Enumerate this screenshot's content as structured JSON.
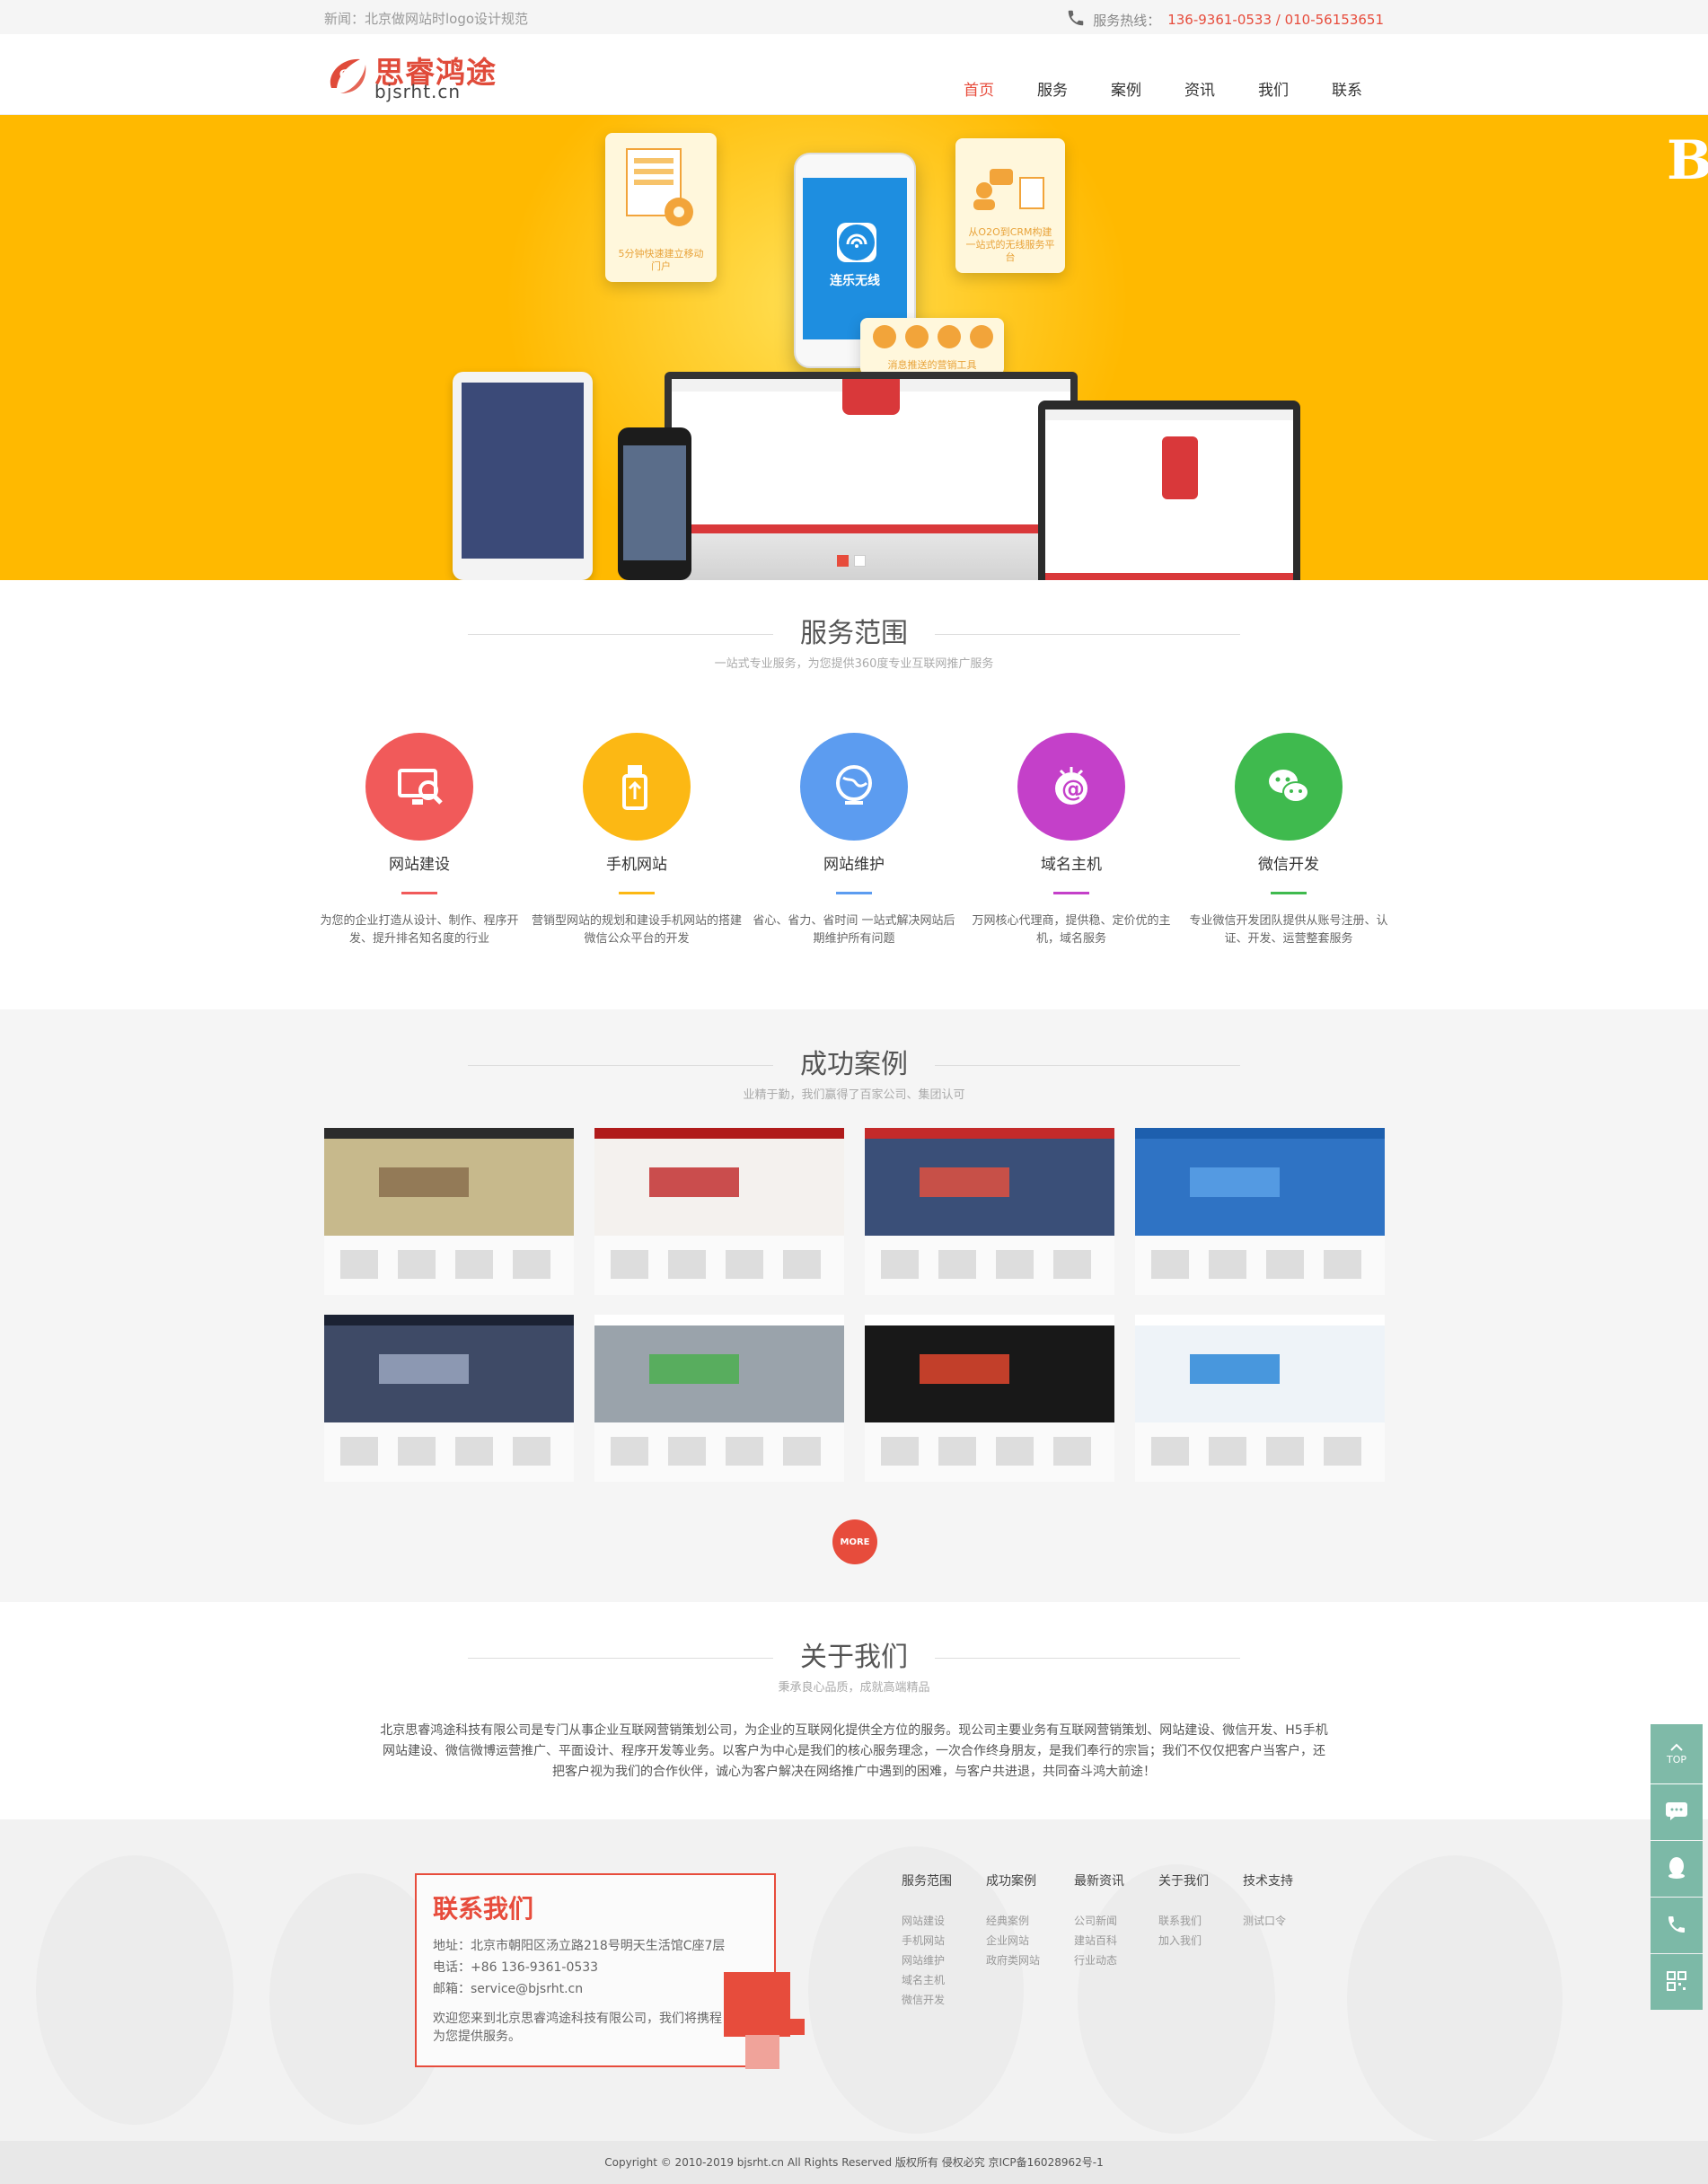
{
  "topbar": {
    "news": "新闻：北京做网站时logo设计规范",
    "hotline_label": "服务热线：",
    "hotline_numbers": "136-9361-0533 / 010-56153651"
  },
  "header": {
    "logo_cn": "思睿鸿途",
    "logo_en": "bjsrht.cn",
    "nav": [
      "首页",
      "服务",
      "案例",
      "资讯",
      "我们",
      "联系"
    ]
  },
  "banner": {
    "card_left": "5分钟快速建立移动门户",
    "card_right": "从O2O到CRM构建一站式的无线服务平台",
    "card_bottom": "消息推送的营销工具",
    "phone_app": "连乐无线",
    "big_letter": "B"
  },
  "services": {
    "title": "服务范围",
    "subtitle": "一站式专业服务，为您提供360度专业互联网推广服务",
    "items": [
      {
        "name": "网站建设",
        "desc": "为您的企业打造从设计、制作、程序开发、提升排名知名度的行业",
        "color": "#f15a5a",
        "icon": "monitor-search-icon"
      },
      {
        "name": "手机网站",
        "desc": "营销型网站的规划和建设手机网站的搭建微信公众平台的开发",
        "color": "#fcb814",
        "icon": "usb-drive-icon"
      },
      {
        "name": "网站维护",
        "desc": "省心、省力、省时间 一站式解决网站后期维护所有问题",
        "color": "#5c9cf0",
        "icon": "globe-icon"
      },
      {
        "name": "域名主机",
        "desc": "万网核心代理商，提供稳、定价优的主机，域名服务",
        "color": "#c440c9",
        "icon": "at-sign-icon"
      },
      {
        "name": "微信开发",
        "desc": "专业微信开发团队提供从账号注册、认证、开发、运营整套服务",
        "color": "#3fba4e",
        "icon": "wechat-icon"
      }
    ]
  },
  "cases": {
    "title": "成功案例",
    "subtitle": "业精于勤，我们赢得了百家公司、集团认可",
    "items": [
      {
        "top": "#2c2c2c",
        "hero": "#c7b98c",
        "accent": "#8a6f4e"
      },
      {
        "top": "#b01b1b",
        "hero": "#f4f1ee",
        "accent": "#c23030"
      },
      {
        "top": "#c42a2a",
        "hero": "#3a4f78",
        "accent": "#e05040"
      },
      {
        "top": "#1d5fae",
        "hero": "#2f73c4",
        "accent": "#5aa1e8"
      },
      {
        "top": "#1b2233",
        "hero": "#3e4a66",
        "accent": "#9aa6c0"
      },
      {
        "top": "#ffffff",
        "hero": "#9aa3ab",
        "accent": "#4caf50"
      },
      {
        "top": "#ffffff",
        "hero": "#181818",
        "accent": "#e0462e"
      },
      {
        "top": "#ffffff",
        "hero": "#eef3f8",
        "accent": "#2a86d8"
      }
    ],
    "more_label": "MORE"
  },
  "about": {
    "title": "关于我们",
    "subtitle": "秉承良心品质，成就高端精品",
    "text": "北京思睿鸿途科技有限公司是专门从事企业互联网营销策划公司，为企业的互联网化提供全方位的服务。现公司主要业务有互联网营销策划、网站建设、微信开发、H5手机网站建设、微信微博运营推广、平面设计、程序开发等业务。以客户为中心是我们的核心服务理念，一次合作终身朋友，是我们奉行的宗旨；我们不仅仅把客户当客户，还把客户视为我们的合作伙伴，诚心为客户解决在网络推广中遇到的困难，与客户共进退，共同奋斗鸿大前途！"
  },
  "footer": {
    "contact_title": "联系我们",
    "address": "地址：北京市朝阳区汤立路218号明天生活馆C座7层",
    "phone": "电话：+86 136-9361-0533",
    "email": "邮箱：service@bjsrht.cn",
    "welcome": "欢迎您来到北京思睿鸿途科技有限公司，我们将携程为您提供服务。",
    "columns": [
      {
        "title": "服务范围",
        "links": [
          "网站建设",
          "手机网站",
          "网站维护",
          "域名主机",
          "微信开发"
        ]
      },
      {
        "title": "成功案例",
        "links": [
          "经典案例",
          "企业网站",
          "政府类网站"
        ]
      },
      {
        "title": "最新资讯",
        "links": [
          "公司新闻",
          "建站百科",
          "行业动态"
        ]
      },
      {
        "title": "关于我们",
        "links": [
          "联系我们",
          "加入我们"
        ]
      },
      {
        "title": "技术支持",
        "links": [
          "测试口令"
        ]
      }
    ],
    "copyright": "Copyright © 2010-2019 bjsrht.cn All Rights Reserved 版权所有 侵权必究     京ICP备16028962号-1"
  },
  "side_tools": [
    {
      "icon": "top-arrow-icon",
      "label": "TOP"
    },
    {
      "icon": "chat-icon",
      "label": ""
    },
    {
      "icon": "qq-icon",
      "label": ""
    },
    {
      "icon": "phone-icon",
      "label": ""
    },
    {
      "icon": "qrcode-icon",
      "label": ""
    }
  ]
}
